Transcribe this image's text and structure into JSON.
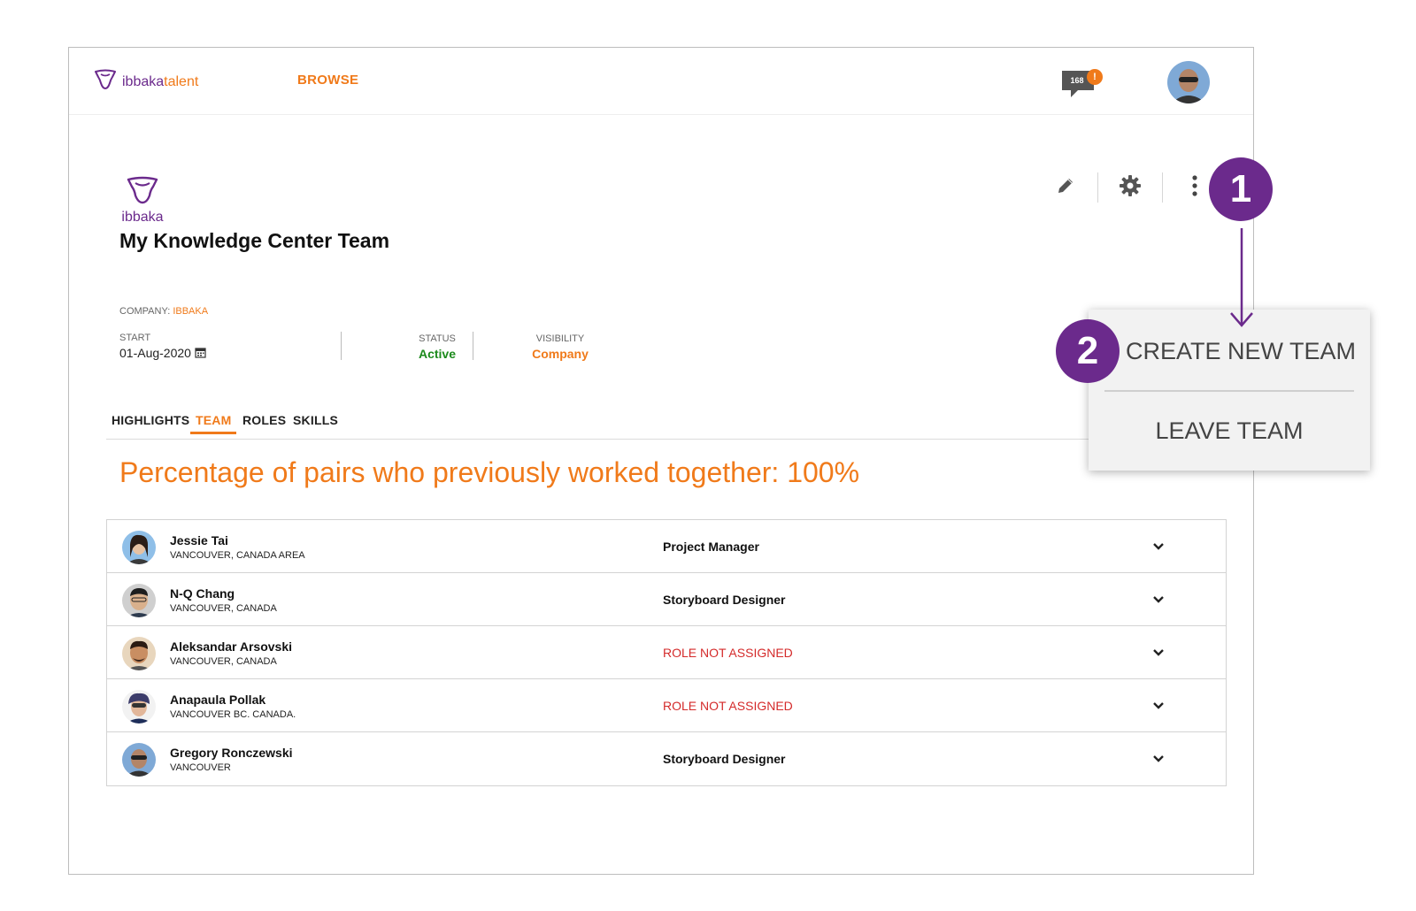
{
  "header": {
    "brand_part1": "ibbaka",
    "brand_part2": "talent",
    "nav_browse": "BROWSE",
    "notification_count": "168",
    "notification_badge": "!",
    "icons": [
      "ibbaka-logo-icon",
      "chat-bubble-icon",
      "user-avatar"
    ]
  },
  "team": {
    "logo_word": "ibbaka",
    "title": "My Knowledge Center Team",
    "company_label": "COMPANY:",
    "company_value": "IBBAKA",
    "start_label": "START",
    "start_value": "01-Aug-2020",
    "status_label": "STATUS",
    "status_value": "Active",
    "visibility_label": "VISIBILITY",
    "visibility_value": "Company",
    "action_icons": [
      "pencil-icon",
      "gear-icon",
      "more-vertical-icon"
    ]
  },
  "tabs": [
    {
      "label": "HIGHLIGHTS",
      "active": false
    },
    {
      "label": "TEAM",
      "active": true
    },
    {
      "label": "ROLES",
      "active": false
    },
    {
      "label": "SKILLS",
      "active": false
    }
  ],
  "pairs_text": "Percentage of pairs who previously worked together: 100%",
  "members": [
    {
      "name": "Jessie Tai",
      "location": "VANCOUVER, CANADA AREA",
      "role": "Project Manager",
      "role_assigned": true
    },
    {
      "name": "N-Q Chang",
      "location": "VANCOUVER, CANADA",
      "role": "Storyboard Designer",
      "role_assigned": true
    },
    {
      "name": "Aleksandar Arsovski",
      "location": "VANCOUVER, CANADA",
      "role": "ROLE NOT ASSIGNED",
      "role_assigned": false
    },
    {
      "name": "Anapaula Pollak",
      "location": "VANCOUVER BC. CANADA.",
      "role": "ROLE NOT ASSIGNED",
      "role_assigned": false
    },
    {
      "name": "Gregory Ronczewski",
      "location": "VANCOUVER",
      "role": "Storyboard Designer",
      "role_assigned": true
    }
  ],
  "menu": {
    "create_new_team": "CREATE NEW TEAM",
    "leave_team": "LEAVE TEAM"
  },
  "annotations": {
    "step1": "1",
    "step2": "2"
  },
  "colors": {
    "brand_purple": "#6b2a8c",
    "accent_orange": "#f07a1a",
    "status_green": "#1b8a1b",
    "alert_red": "#d42a2a"
  }
}
